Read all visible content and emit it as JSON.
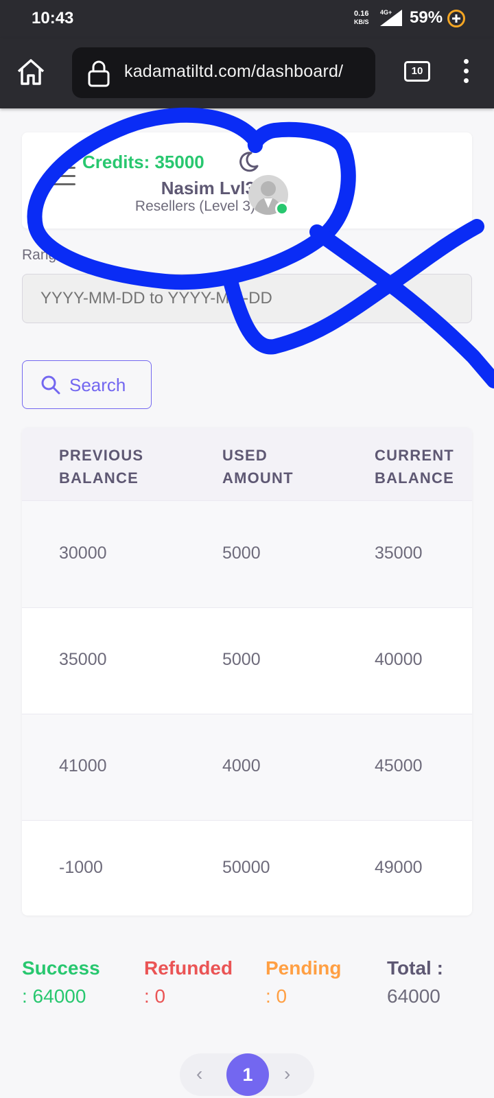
{
  "status_bar": {
    "time": "10:43",
    "speed_value": "0.16",
    "speed_unit": "KB/S",
    "network": "4G+",
    "battery": "59%"
  },
  "browser": {
    "url": "kadamatiltd.com/dashboard/",
    "tab_count": "10",
    "icons": [
      "home-icon",
      "lock-icon",
      "tabs-icon",
      "menu-icon"
    ]
  },
  "profile": {
    "credits": "Credits: 35000",
    "name": "Nasim Lvl3",
    "role": "Resellers (Level 3)",
    "status_color": "#28c76f"
  },
  "filter": {
    "range_label": "Range",
    "date_placeholder": "YYYY-MM-DD to YYYY-MM-DD",
    "search_label": "Search"
  },
  "table": {
    "headers": [
      [
        "PREVIOUS",
        "BALANCE"
      ],
      [
        "USED",
        "AMOUNT"
      ],
      [
        "CURRENT",
        "BALANCE"
      ]
    ],
    "rows": [
      [
        "30000",
        "5000",
        "35000"
      ],
      [
        "35000",
        "5000",
        "40000"
      ],
      [
        "41000",
        "4000",
        "45000"
      ],
      [
        "-1000",
        "50000",
        "49000"
      ]
    ]
  },
  "summary": {
    "success_label": "Success",
    "success_value": ": 64000",
    "refunded_label": "Refunded",
    "refunded_value": ": 0",
    "pending_label": "Pending",
    "pending_value": ": 0",
    "total_label": "Total :",
    "total_value": "64000",
    "colors": {
      "success": "#28c76f",
      "refunded": "#ea5455",
      "pending": "#ff9f43"
    }
  },
  "pagination": {
    "prev": "‹",
    "current": "1",
    "next": "›"
  },
  "overlay": {
    "annotation_color": "#0a2cf5"
  }
}
